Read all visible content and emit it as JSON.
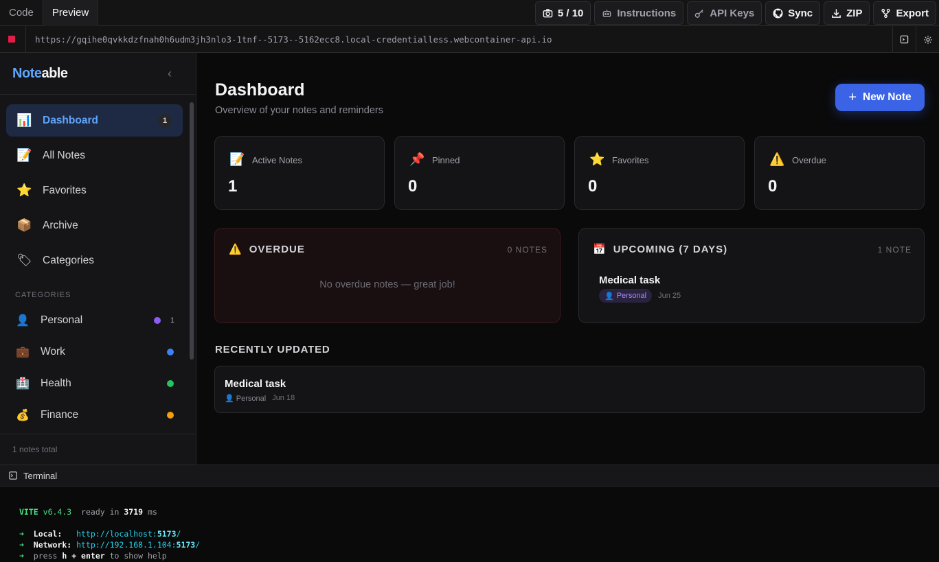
{
  "topbar": {
    "tabs": [
      "Code",
      "Preview"
    ],
    "screenshot_count": "5 / 10",
    "instructions": "Instructions",
    "api_keys": "API Keys",
    "sync": "Sync",
    "zip": "ZIP",
    "export": "Export"
  },
  "urlbar": {
    "url": "https://gqihe0qvkkdzfnah0h6udm3jh3nlo3-1tnf--5173--5162ecc8.local-credentialless.webcontainer-api.io"
  },
  "sidebar": {
    "brand_1": "Note",
    "brand_2": "able",
    "nav": [
      {
        "label": "Dashboard",
        "icon": "bar-chart-icon",
        "glyph": "📊",
        "badge": "1"
      },
      {
        "label": "All Notes",
        "icon": "memo-icon",
        "glyph": "📝"
      },
      {
        "label": "Favorites",
        "icon": "star-icon",
        "glyph": "⭐"
      },
      {
        "label": "Archive",
        "icon": "package-icon",
        "glyph": "📦"
      },
      {
        "label": "Categories",
        "icon": "tag-icon",
        "glyph": "🏷"
      }
    ],
    "categories_heading": "CATEGORIES",
    "categories": [
      {
        "label": "Personal",
        "glyph": "👤",
        "color": "#8b5cf6",
        "count": "1"
      },
      {
        "label": "Work",
        "glyph": "💼",
        "color": "#3b82f6"
      },
      {
        "label": "Health",
        "glyph": "🏥",
        "color": "#22c55e"
      },
      {
        "label": "Finance",
        "glyph": "💰",
        "color": "#f59e0b"
      }
    ],
    "footer": "1 notes total"
  },
  "main": {
    "title": "Dashboard",
    "subtitle": "Overview of your notes and reminders",
    "new_note": "New Note",
    "stats": [
      {
        "label": "Active Notes",
        "glyph": "📝",
        "value": "1"
      },
      {
        "label": "Pinned",
        "glyph": "📌",
        "value": "0"
      },
      {
        "label": "Favorites",
        "glyph": "⭐",
        "value": "0"
      },
      {
        "label": "Overdue",
        "glyph": "⚠️",
        "value": "0"
      }
    ],
    "overdue": {
      "heading": "OVERDUE",
      "count": "0 NOTES",
      "empty": "No overdue notes — great job!"
    },
    "upcoming": {
      "heading": "UPCOMING (7 DAYS)",
      "count": "1 NOTE",
      "item_title": "Medical task",
      "item_category": "Personal",
      "item_date": "Jun 25"
    },
    "recent_heading": "RECENTLY UPDATED",
    "recent": {
      "title": "Medical task",
      "category": "Personal",
      "date": "Jun 18"
    }
  },
  "terminal": {
    "label": "Terminal",
    "vite": "VITE",
    "version": "v6.4.3",
    "ready": "ready in",
    "ms_value": "3719",
    "ms": "ms",
    "local_label": "Local:",
    "local_url_a": "http://localhost:",
    "local_port": "5173",
    "network_label": "Network:",
    "network_url_a": "http://192.168.1.104:",
    "network_port": "5173",
    "help_a": "press",
    "help_key": "h + enter",
    "help_b": "to show help"
  }
}
